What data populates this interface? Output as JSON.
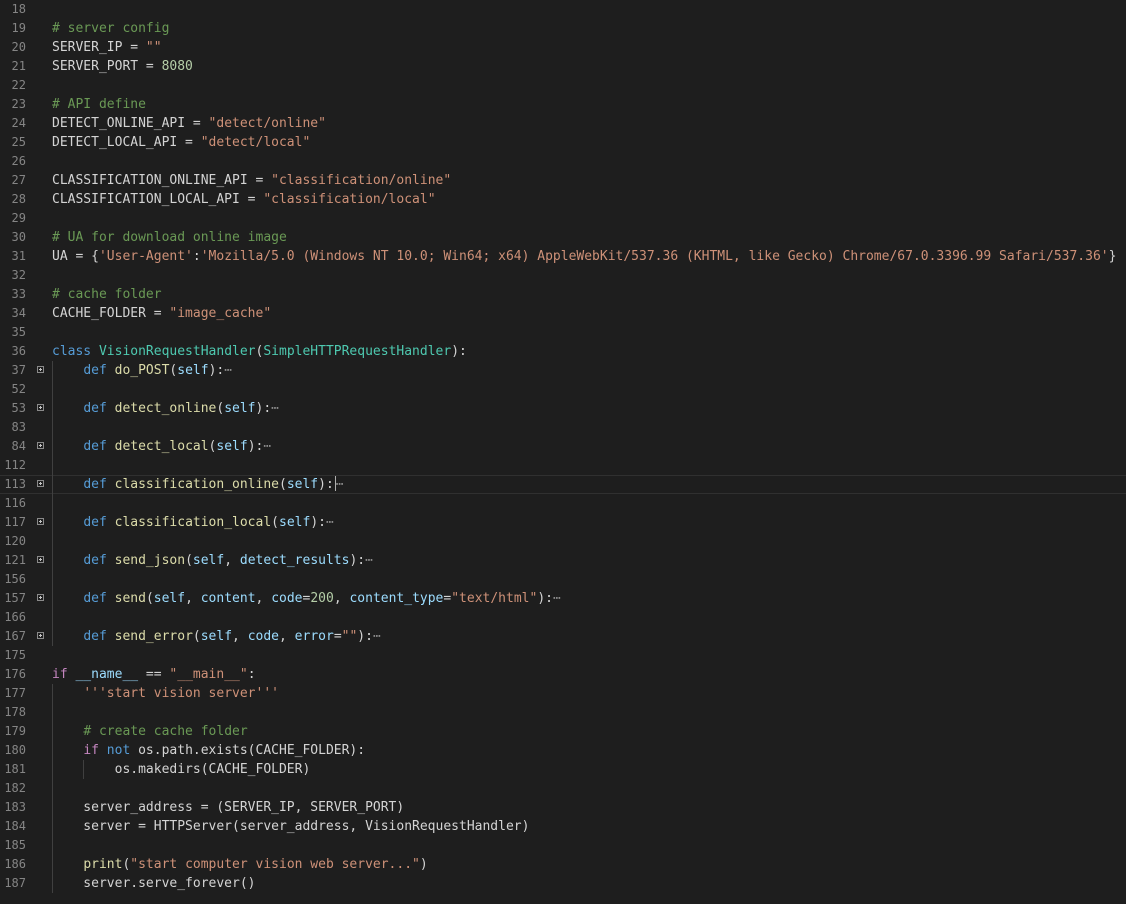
{
  "editor": {
    "cursor_line": "113",
    "lines": [
      {
        "n": "18",
        "tokens": []
      },
      {
        "n": "19",
        "tokens": [
          {
            "t": "# server config",
            "c": "cmt"
          }
        ]
      },
      {
        "n": "20",
        "tokens": [
          {
            "t": "SERVER_IP = "
          },
          {
            "t": "\"\"",
            "c": "str"
          }
        ]
      },
      {
        "n": "21",
        "tokens": [
          {
            "t": "SERVER_PORT = "
          },
          {
            "t": "8080",
            "c": "num"
          }
        ]
      },
      {
        "n": "22",
        "tokens": []
      },
      {
        "n": "23",
        "tokens": [
          {
            "t": "# API define",
            "c": "cmt"
          }
        ]
      },
      {
        "n": "24",
        "tokens": [
          {
            "t": "DETECT_ONLINE_API = "
          },
          {
            "t": "\"detect/online\"",
            "c": "str"
          }
        ]
      },
      {
        "n": "25",
        "tokens": [
          {
            "t": "DETECT_LOCAL_API = "
          },
          {
            "t": "\"detect/local\"",
            "c": "str"
          }
        ]
      },
      {
        "n": "26",
        "tokens": []
      },
      {
        "n": "27",
        "tokens": [
          {
            "t": "CLASSIFICATION_ONLINE_API = "
          },
          {
            "t": "\"classification/online\"",
            "c": "str"
          }
        ]
      },
      {
        "n": "28",
        "tokens": [
          {
            "t": "CLASSIFICATION_LOCAL_API = "
          },
          {
            "t": "\"classification/local\"",
            "c": "str"
          }
        ]
      },
      {
        "n": "29",
        "tokens": []
      },
      {
        "n": "30",
        "tokens": [
          {
            "t": "# UA for download online image",
            "c": "cmt"
          }
        ]
      },
      {
        "n": "31",
        "tokens": [
          {
            "t": "UA = {"
          },
          {
            "t": "'User-Agent'",
            "c": "str"
          },
          {
            "t": ":"
          },
          {
            "t": "'Mozilla/5.0 (Windows NT 10.0; Win64; x64) AppleWebKit/537.36 (KHTML, like Gecko) Chrome/67.0.3396.99 Safari/537.36'",
            "c": "str"
          },
          {
            "t": "}"
          }
        ]
      },
      {
        "n": "32",
        "tokens": []
      },
      {
        "n": "33",
        "tokens": [
          {
            "t": "# cache folder",
            "c": "cmt"
          }
        ]
      },
      {
        "n": "34",
        "tokens": [
          {
            "t": "CACHE_FOLDER = "
          },
          {
            "t": "\"image_cache\"",
            "c": "str"
          }
        ]
      },
      {
        "n": "35",
        "tokens": []
      },
      {
        "n": "36",
        "tokens": [
          {
            "t": "class ",
            "c": "kw"
          },
          {
            "t": "VisionRequestHandler",
            "c": "cls"
          },
          {
            "t": "("
          },
          {
            "t": "SimpleHTTPRequestHandler",
            "c": "cls"
          },
          {
            "t": "):"
          }
        ]
      },
      {
        "n": "37",
        "fold": true,
        "tokens": [
          {
            "t": "    "
          },
          {
            "t": "def ",
            "c": "kw"
          },
          {
            "t": "do_POST",
            "c": "fn"
          },
          {
            "t": "("
          },
          {
            "t": "self",
            "c": "var"
          },
          {
            "t": "):"
          },
          {
            "t": "⋯",
            "c": "ell"
          }
        ]
      },
      {
        "n": "52",
        "tokens": []
      },
      {
        "n": "53",
        "fold": true,
        "tokens": [
          {
            "t": "    "
          },
          {
            "t": "def ",
            "c": "kw"
          },
          {
            "t": "detect_online",
            "c": "fn"
          },
          {
            "t": "("
          },
          {
            "t": "self",
            "c": "var"
          },
          {
            "t": "):"
          },
          {
            "t": "⋯",
            "c": "ell"
          }
        ]
      },
      {
        "n": "83",
        "tokens": []
      },
      {
        "n": "84",
        "fold": true,
        "tokens": [
          {
            "t": "    "
          },
          {
            "t": "def ",
            "c": "kw"
          },
          {
            "t": "detect_local",
            "c": "fn"
          },
          {
            "t": "("
          },
          {
            "t": "self",
            "c": "var"
          },
          {
            "t": "):"
          },
          {
            "t": "⋯",
            "c": "ell"
          }
        ]
      },
      {
        "n": "112",
        "tokens": []
      },
      {
        "n": "113",
        "fold": true,
        "current": true,
        "tokens": [
          {
            "t": "    "
          },
          {
            "t": "def ",
            "c": "kw"
          },
          {
            "t": "classification_online",
            "c": "fn"
          },
          {
            "t": "("
          },
          {
            "t": "self",
            "c": "var"
          },
          {
            "t": "):"
          },
          {
            "cursor": true
          },
          {
            "t": "⋯",
            "c": "ell"
          }
        ]
      },
      {
        "n": "116",
        "tokens": []
      },
      {
        "n": "117",
        "fold": true,
        "tokens": [
          {
            "t": "    "
          },
          {
            "t": "def ",
            "c": "kw"
          },
          {
            "t": "classification_local",
            "c": "fn"
          },
          {
            "t": "("
          },
          {
            "t": "self",
            "c": "var"
          },
          {
            "t": "):"
          },
          {
            "t": "⋯",
            "c": "ell"
          }
        ]
      },
      {
        "n": "120",
        "tokens": []
      },
      {
        "n": "121",
        "fold": true,
        "tokens": [
          {
            "t": "    "
          },
          {
            "t": "def ",
            "c": "kw"
          },
          {
            "t": "send_json",
            "c": "fn"
          },
          {
            "t": "("
          },
          {
            "t": "self",
            "c": "var"
          },
          {
            "t": ", "
          },
          {
            "t": "detect_results",
            "c": "var"
          },
          {
            "t": "):"
          },
          {
            "t": "⋯",
            "c": "ell"
          }
        ]
      },
      {
        "n": "156",
        "tokens": []
      },
      {
        "n": "157",
        "fold": true,
        "tokens": [
          {
            "t": "    "
          },
          {
            "t": "def ",
            "c": "kw"
          },
          {
            "t": "send",
            "c": "fn"
          },
          {
            "t": "("
          },
          {
            "t": "self",
            "c": "var"
          },
          {
            "t": ", "
          },
          {
            "t": "content",
            "c": "var"
          },
          {
            "t": ", "
          },
          {
            "t": "code",
            "c": "var"
          },
          {
            "t": "="
          },
          {
            "t": "200",
            "c": "num"
          },
          {
            "t": ", "
          },
          {
            "t": "content_type",
            "c": "var"
          },
          {
            "t": "="
          },
          {
            "t": "\"text/html\"",
            "c": "str"
          },
          {
            "t": "):"
          },
          {
            "t": "⋯",
            "c": "ell"
          }
        ]
      },
      {
        "n": "166",
        "tokens": []
      },
      {
        "n": "167",
        "fold": true,
        "tokens": [
          {
            "t": "    "
          },
          {
            "t": "def ",
            "c": "kw"
          },
          {
            "t": "send_error",
            "c": "fn"
          },
          {
            "t": "("
          },
          {
            "t": "self",
            "c": "var"
          },
          {
            "t": ", "
          },
          {
            "t": "code",
            "c": "var"
          },
          {
            "t": ", "
          },
          {
            "t": "error",
            "c": "var"
          },
          {
            "t": "="
          },
          {
            "t": "\"\"",
            "c": "str"
          },
          {
            "t": "):"
          },
          {
            "t": "⋯",
            "c": "ell"
          }
        ]
      },
      {
        "n": "175",
        "tokens": []
      },
      {
        "n": "176",
        "tokens": [
          {
            "t": "if ",
            "c": "ctl"
          },
          {
            "t": "__name__",
            "c": "var"
          },
          {
            "t": " == "
          },
          {
            "t": "\"__main__\"",
            "c": "str"
          },
          {
            "t": ":"
          }
        ]
      },
      {
        "n": "177",
        "tokens": [
          {
            "t": "    "
          },
          {
            "t": "'''start vision server'''",
            "c": "str"
          }
        ]
      },
      {
        "n": "178",
        "tokens": []
      },
      {
        "n": "179",
        "tokens": [
          {
            "t": "    "
          },
          {
            "t": "# create cache folder",
            "c": "cmt"
          }
        ]
      },
      {
        "n": "180",
        "tokens": [
          {
            "t": "    "
          },
          {
            "t": "if ",
            "c": "ctl"
          },
          {
            "t": "not ",
            "c": "kw"
          },
          {
            "t": "os.path.exists(CACHE_FOLDER):"
          }
        ]
      },
      {
        "n": "181",
        "tokens": [
          {
            "t": "        os.makedirs(CACHE_FOLDER)"
          }
        ]
      },
      {
        "n": "182",
        "tokens": []
      },
      {
        "n": "183",
        "tokens": [
          {
            "t": "    server_address = (SERVER_IP, SERVER_PORT)"
          }
        ]
      },
      {
        "n": "184",
        "tokens": [
          {
            "t": "    server = HTTPServer(server_address, VisionRequestHandler)"
          }
        ]
      },
      {
        "n": "185",
        "tokens": []
      },
      {
        "n": "186",
        "tokens": [
          {
            "t": "    "
          },
          {
            "t": "print",
            "c": "fn"
          },
          {
            "t": "("
          },
          {
            "t": "\"start computer vision web server...\"",
            "c": "str"
          },
          {
            "t": ")"
          }
        ]
      },
      {
        "n": "187",
        "tokens": [
          {
            "t": "    server.serve_forever()"
          }
        ]
      }
    ]
  }
}
